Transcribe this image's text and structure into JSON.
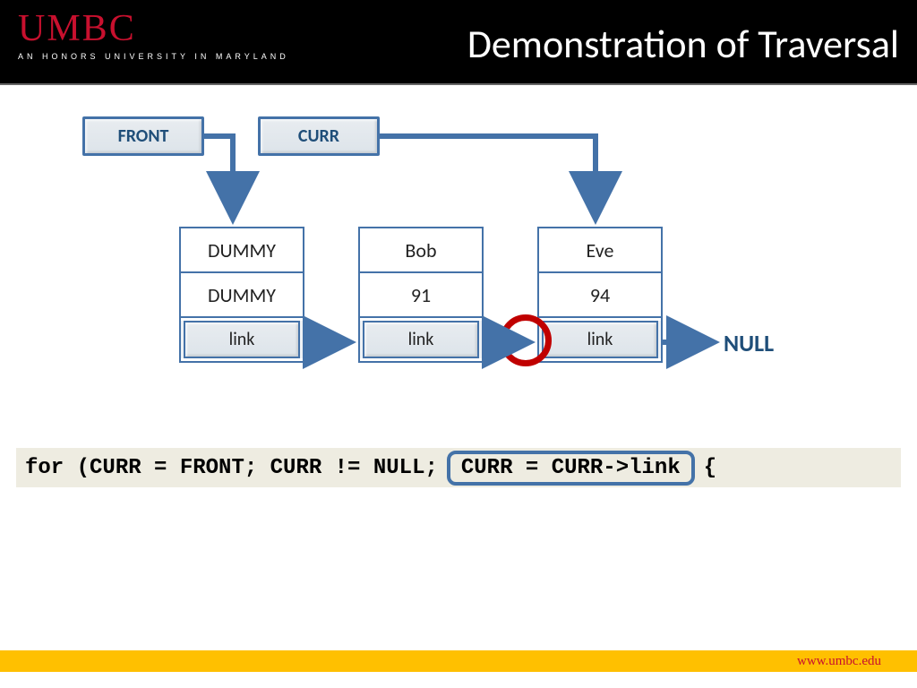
{
  "header": {
    "logo_main": "UMBC",
    "logo_sub": "AN HONORS UNIVERSITY IN MARYLAND",
    "title": "Demonstration of Traversal"
  },
  "pointers": {
    "front": "FRONT",
    "curr": "CURR"
  },
  "nodes": [
    {
      "name": "DUMMY",
      "value": "DUMMY",
      "link": "link"
    },
    {
      "name": "Bob",
      "value": "91",
      "link": "link"
    },
    {
      "name": "Eve",
      "value": "94",
      "link": "link"
    }
  ],
  "null_label": "NULL",
  "code": {
    "pre": "for (CURR = FRONT; CURR != NULL;",
    "highlight": "CURR = CURR->link",
    "post": " {"
  },
  "footer": {
    "url": "www.umbc.edu"
  },
  "colors": {
    "arrow": "#4472a8"
  }
}
